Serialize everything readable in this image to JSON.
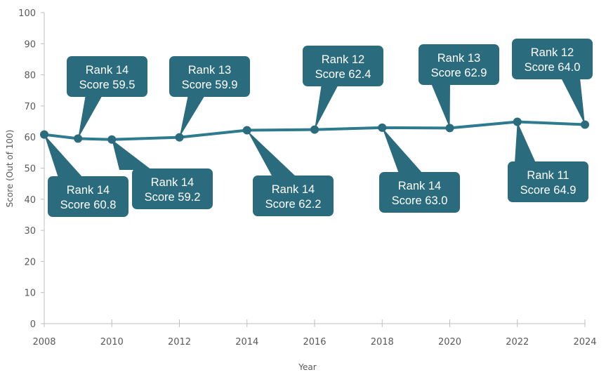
{
  "chart_data": {
    "type": "line",
    "title": "",
    "xlabel": "Year",
    "ylabel": "Score (Out of 100)",
    "xlim": [
      2008,
      2024
    ],
    "ylim": [
      0,
      100
    ],
    "x_ticks": [
      2008,
      2010,
      2012,
      2014,
      2016,
      2018,
      2020,
      2022,
      2024
    ],
    "y_ticks": [
      0,
      10,
      20,
      30,
      40,
      50,
      60,
      70,
      80,
      90,
      100
    ],
    "grid": false,
    "legend": null,
    "colors": {
      "series": "#2e7b90",
      "callout": "#2a6b7e",
      "axis": "#bfbfbf",
      "text": "#595959"
    },
    "series": [
      {
        "name": "Score",
        "x": [
          2008,
          2009,
          2010,
          2012,
          2014,
          2016,
          2018,
          2020,
          2022,
          2024
        ],
        "values": [
          60.8,
          59.5,
          59.2,
          59.9,
          62.2,
          62.4,
          63.0,
          62.9,
          64.9,
          64.0
        ],
        "ranks": [
          14,
          14,
          14,
          13,
          14,
          12,
          14,
          13,
          11,
          12
        ]
      }
    ],
    "annotations": [
      {
        "x": 2008,
        "line1": "Rank 14",
        "line2": "Score 60.8",
        "position": "below"
      },
      {
        "x": 2009,
        "line1": "Rank 14",
        "line2": "Score 59.5",
        "position": "above"
      },
      {
        "x": 2010,
        "line1": "Rank 14",
        "line2": "Score 59.2",
        "position": "below"
      },
      {
        "x": 2012,
        "line1": "Rank 13",
        "line2": "Score 59.9",
        "position": "above"
      },
      {
        "x": 2014,
        "line1": "Rank 14",
        "line2": "Score 62.2",
        "position": "below"
      },
      {
        "x": 2016,
        "line1": "Rank 12",
        "line2": "Score 62.4",
        "position": "above"
      },
      {
        "x": 2018,
        "line1": "Rank 14",
        "line2": "Score 63.0",
        "position": "below"
      },
      {
        "x": 2020,
        "line1": "Rank 13",
        "line2": "Score 62.9",
        "position": "above"
      },
      {
        "x": 2022,
        "line1": "Rank 11",
        "line2": "Score 64.9",
        "position": "below"
      },
      {
        "x": 2024,
        "line1": "Rank 12",
        "line2": "Score 64.0",
        "position": "above"
      }
    ]
  }
}
